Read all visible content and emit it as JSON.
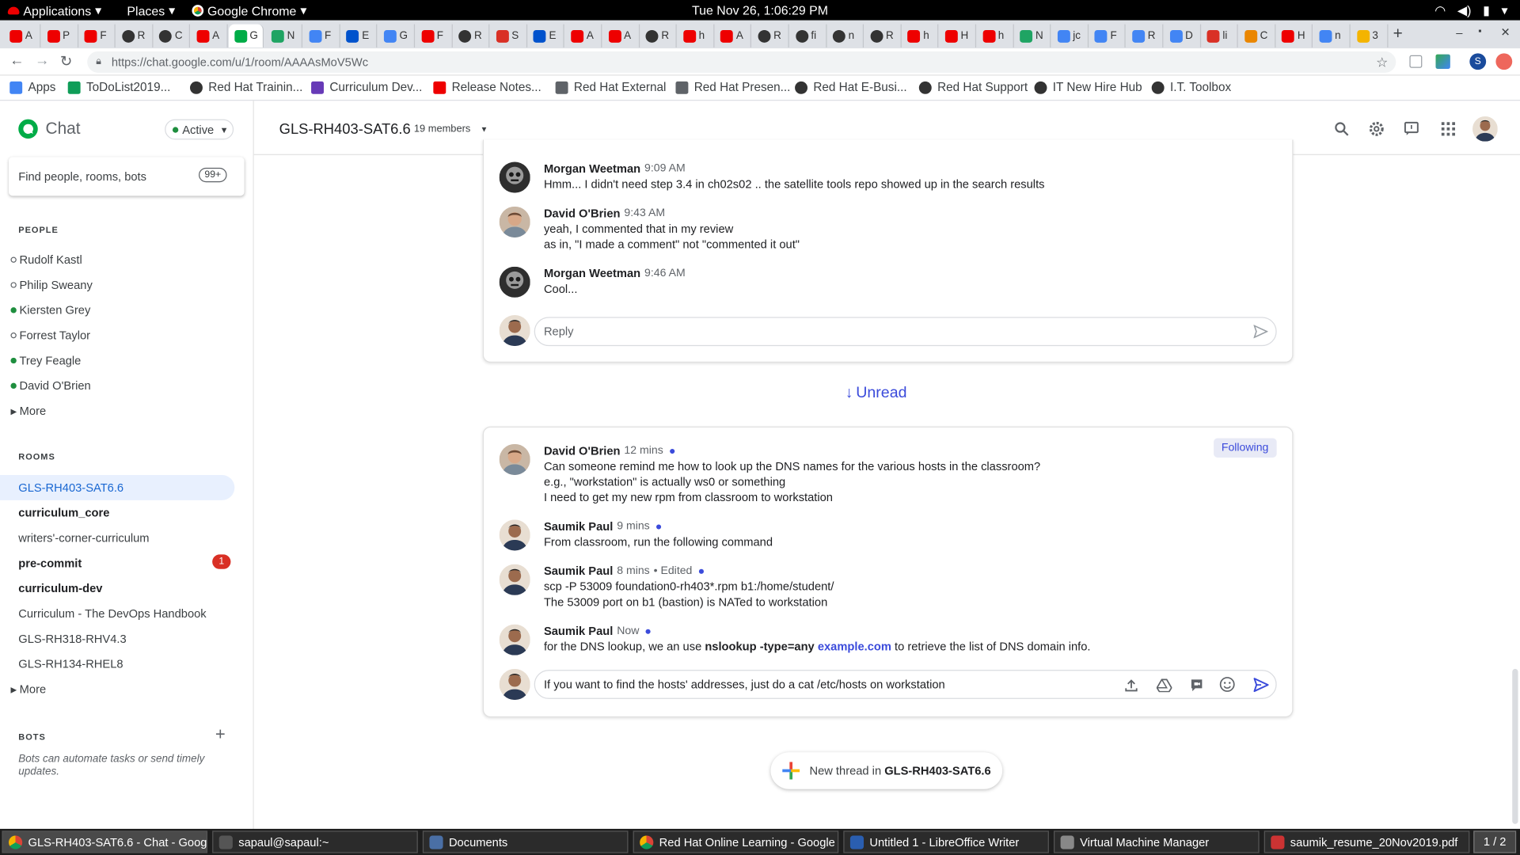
{
  "topbar": {
    "applications": "Applications",
    "places": "Places",
    "browser": "Google Chrome",
    "clock": "Tue Nov 26,  1:06:29 PM"
  },
  "tabs": [
    {
      "label": "A",
      "icon": "redhat-icon"
    },
    {
      "label": "P",
      "icon": "redhat-icon"
    },
    {
      "label": "F",
      "icon": "redhat-icon"
    },
    {
      "label": "R",
      "icon": "github-icon"
    },
    {
      "label": "C",
      "icon": "github-icon"
    },
    {
      "label": "A",
      "icon": "redhat-icon"
    },
    {
      "label": "G",
      "icon": "chat-icon",
      "active": true
    },
    {
      "label": "N",
      "icon": "drive-icon"
    },
    {
      "label": "F",
      "icon": "calendar-icon"
    },
    {
      "label": "E",
      "icon": "jira-icon"
    },
    {
      "label": "G",
      "icon": "docs-icon"
    },
    {
      "label": "F",
      "icon": "redhat-icon"
    },
    {
      "label": "R",
      "icon": "github-icon"
    },
    {
      "label": "S",
      "icon": "gmail-icon"
    },
    {
      "label": "E",
      "icon": "jira-icon"
    },
    {
      "label": "A",
      "icon": "redhat-icon"
    },
    {
      "label": "A",
      "icon": "redhat-icon"
    },
    {
      "label": "R",
      "icon": "github-icon"
    },
    {
      "label": "h",
      "icon": "redhat-icon"
    },
    {
      "label": "A",
      "icon": "redhat-icon"
    },
    {
      "label": "R",
      "icon": "github-icon"
    },
    {
      "label": "fi",
      "icon": "github-icon"
    },
    {
      "label": "n",
      "icon": "github-icon"
    },
    {
      "label": "R",
      "icon": "github-icon"
    },
    {
      "label": "h",
      "icon": "redhat-icon"
    },
    {
      "label": "H",
      "icon": "redhat-icon"
    },
    {
      "label": "h",
      "icon": "redhat-icon"
    },
    {
      "label": "N",
      "icon": "drive-icon"
    },
    {
      "label": "jc",
      "icon": "docs-icon"
    },
    {
      "label": "F",
      "icon": "docs-icon"
    },
    {
      "label": "R",
      "icon": "docs-icon"
    },
    {
      "label": "D",
      "icon": "docs-icon"
    },
    {
      "label": "li",
      "icon": "gmail-icon"
    },
    {
      "label": "C",
      "icon": "maps-icon"
    },
    {
      "label": "H",
      "icon": "redhat-icon"
    },
    {
      "label": "n",
      "icon": "google-icon"
    },
    {
      "label": "3",
      "icon": "slides-icon"
    }
  ],
  "address": {
    "url": "https://chat.google.com/u/1/room/AAAAsMoV5Wc"
  },
  "bookmarks": [
    "Apps",
    "ToDoList2019...",
    "Red Hat Trainin...",
    "Curriculum Dev...",
    "Release Notes...",
    "Red Hat External",
    "Red Hat Presen...",
    "Red Hat E-Busi...",
    "Red Hat Support",
    "IT New Hire Hub",
    "I.T. Toolbox"
  ],
  "sidebar": {
    "app_name": "Chat",
    "status": "Active",
    "search_placeholder": "Find people, rooms, bots",
    "search_badge": "99+",
    "people_header": "PEOPLE",
    "people": [
      {
        "name": "Rudolf Kastl",
        "online": false
      },
      {
        "name": "Philip Sweany",
        "online": false
      },
      {
        "name": "Kiersten Grey",
        "online": true
      },
      {
        "name": "Forrest Taylor",
        "online": false
      },
      {
        "name": "Trey Feagle",
        "online": true
      },
      {
        "name": "David O'Brien",
        "online": true
      }
    ],
    "people_more": "More",
    "rooms_header": "ROOMS",
    "rooms": [
      {
        "name": "GLS-RH403-SAT6.6",
        "selected": true,
        "bold": false
      },
      {
        "name": "curriculum_core",
        "bold": true
      },
      {
        "name": "writers'-corner-curriculum",
        "bold": false
      },
      {
        "name": "pre-commit",
        "bold": true,
        "badge": "1"
      },
      {
        "name": "curriculum-dev",
        "bold": true
      },
      {
        "name": "Curriculum - The DevOps Handbook",
        "bold": false
      },
      {
        "name": "GLS-RH318-RHV4.3",
        "bold": false
      },
      {
        "name": "GLS-RH134-RHEL8",
        "bold": false
      }
    ],
    "rooms_more": "More",
    "bots_header": "BOTS",
    "bots_text": "Bots can automate tasks or send timely updates."
  },
  "room": {
    "name": "GLS-RH403-SAT6.6",
    "members": "19 members"
  },
  "thread1": {
    "messages": [
      {
        "author": "Morgan Weetman",
        "time": "9:09 AM",
        "lines": [
          "Hmm... I didn't need step 3.4 in ch02s02 .. the satellite tools repo showed up in the search results"
        ]
      },
      {
        "author": "David O'Brien",
        "time": "9:43 AM",
        "lines": [
          "yeah, I commented that in my review",
          "as in, \"I made a comment\" not \"commented it out\""
        ]
      },
      {
        "author": "Morgan Weetman",
        "time": "9:46 AM",
        "lines": [
          "Cool..."
        ]
      }
    ],
    "reply_placeholder": "Reply"
  },
  "unread_label": "Unread",
  "thread2": {
    "following": "Following",
    "m1": {
      "author": "David O'Brien",
      "time": "12 mins",
      "l1": "Can someone remind me how to look up the DNS names for the various hosts in the classroom?",
      "l2": "e.g., \"workstation\" is actually ws0 or something",
      "l3": "I need to get my new rpm from classroom to workstation"
    },
    "m2": {
      "author": "Saumik Paul",
      "time": "9 mins",
      "l1": "From classroom, run the following command"
    },
    "m3": {
      "author": "Saumik Paul",
      "time": "8 mins",
      "edited": "• Edited",
      "l1": "scp -P 53009 foundation0-rh403*.rpm b1:/home/student/",
      "l2": "The 53009 port on b1 (bastion) is NATed to workstation"
    },
    "m4": {
      "author": "Saumik Paul",
      "time": "Now",
      "pre": "for the DNS lookup, we an use ",
      "cmd": "nslookup -type=any",
      "link": "example.com",
      "post": " to retrieve the list of DNS domain info."
    },
    "compose_value": "If you want to find the hosts' addresses, just do a cat /etc/hosts on workstation"
  },
  "new_thread": {
    "prefix": "New thread in ",
    "room": "GLS-RH403-SAT6.6"
  },
  "taskbar": [
    {
      "label": "GLS-RH403-SAT6.6 - Chat - Goog...",
      "icon": "chrome-icon",
      "active": true
    },
    {
      "label": "sapaul@sapaul:~",
      "icon": "terminal-icon"
    },
    {
      "label": "Documents",
      "icon": "folder-icon"
    },
    {
      "label": "Red Hat Online Learning - Google ...",
      "icon": "chrome-icon"
    },
    {
      "label": "Untitled 1 - LibreOffice Writer",
      "icon": "writer-icon"
    },
    {
      "label": "Virtual Machine Manager",
      "icon": "vm-icon"
    },
    {
      "label": "saumik_resume_20Nov2019.pdf",
      "icon": "pdf-icon"
    }
  ],
  "workspace": "1 / 2",
  "colors": {
    "accent": "#3b4bdb",
    "selected_room": "#e8f0fe",
    "online": "#1e8e3e",
    "badge": "#d93025",
    "brand_green": "#00ac47"
  }
}
